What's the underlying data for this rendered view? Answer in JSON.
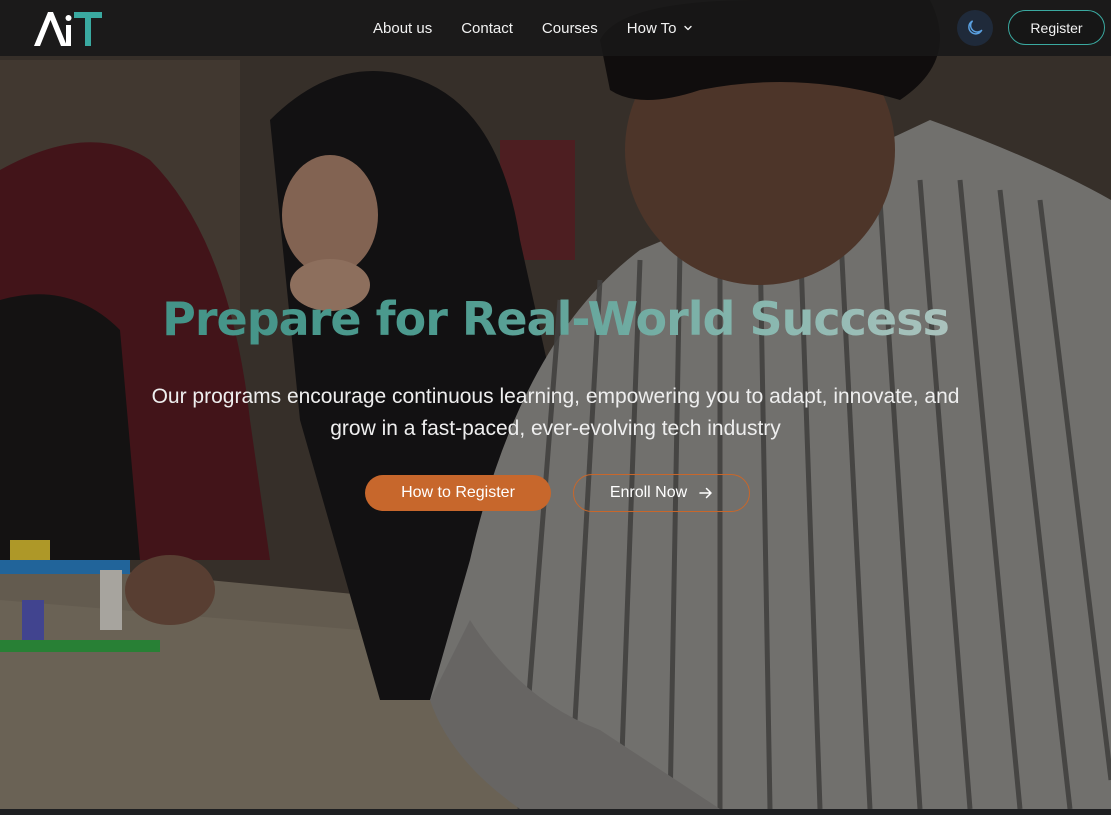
{
  "nav": {
    "logo_text": "AiT",
    "links": [
      {
        "label": "About us"
      },
      {
        "label": "Contact"
      },
      {
        "label": "Courses"
      },
      {
        "label": "How To",
        "has_dropdown": true
      }
    ],
    "theme_toggle_icon": "moon-icon",
    "register_label": "Register"
  },
  "hero": {
    "title": "Prepare for Real-World Success",
    "subtitle": "Our programs encourage continuous learning, empowering you to adapt, innovate, and grow in a fast-paced, ever-evolving tech industry",
    "primary_button": "How to Register",
    "secondary_button": "Enroll Now",
    "secondary_icon": "arrow-right-icon"
  },
  "colors": {
    "accent_teal": "#3aa9a0",
    "accent_orange": "#c7672c",
    "nav_bg": "#181818"
  }
}
